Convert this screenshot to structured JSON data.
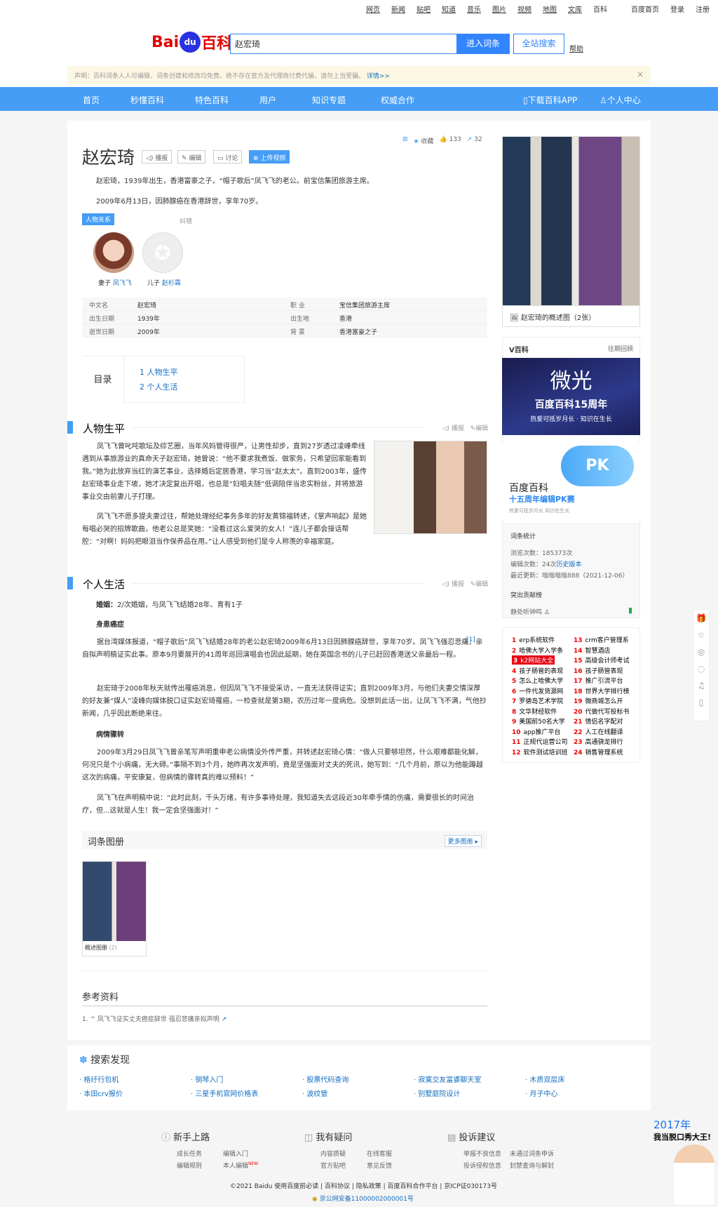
{
  "topnav": {
    "links": [
      "网页",
      "新闻",
      "贴吧",
      "知道",
      "音乐",
      "图片",
      "视频",
      "地图",
      "文库",
      "百科"
    ],
    "right": [
      "百度首页",
      "登录",
      "注册"
    ]
  },
  "header": {
    "logo_bai": "Bai",
    "logo_du": "du",
    "logo_baike": "百科",
    "search_value": "赵宏琦",
    "enter_label": "进入词条",
    "all_search_label": "全站搜索",
    "help_label": "帮助"
  },
  "notice": {
    "text": "声明：百科词条人人可编辑，词条创建和修改均免费，绝不存在官方及代理商付费代编，请勿上当受骗。",
    "link": "详情>>",
    "close": "×"
  },
  "nav": {
    "items": [
      "首页",
      "秒懂百科",
      "特色百科",
      "用户",
      "知识专题",
      "权威合作"
    ],
    "download": "下载百科APP",
    "user_center": "个人中心"
  },
  "entry": {
    "title": "赵宏琦",
    "buttons": [
      "播报",
      "编辑",
      "讨论",
      "上传视频"
    ],
    "collect": "收藏",
    "likes": "133",
    "shares": "32",
    "summary1": "赵宏琦，1939年出生，香港富豪之子，“帽子歌后”凤飞飞的老公。前宝信集团旅游主席。",
    "summary2": "2009年6月13日，因肺腺癌在香港辞世，享年70岁。",
    "relation_tag": "人物关系",
    "relation_error": "纠错",
    "relatives": [
      {
        "role": "妻子",
        "name": "凤飞飞"
      },
      {
        "role": "儿子",
        "name": "赵杉霖"
      }
    ],
    "info": [
      {
        "k1": "中文名",
        "v1": "赵宏琦",
        "k2": "职    业",
        "v2": "宝信集团旅游主席"
      },
      {
        "k1": "出生日期",
        "v1": "1939年",
        "k2": "出生地",
        "v2": "香港"
      },
      {
        "k1": "逝世日期",
        "v1": "2009年",
        "k2": "背    景",
        "v2": "香港富豪之子"
      }
    ],
    "toc_label": "目录",
    "toc": [
      "1   人物生平",
      "2   个人生活"
    ]
  },
  "section1": {
    "title": "人物生平",
    "read": "播报",
    "edit": "编辑",
    "p1": "凤飞飞曾叱咤歌坛及综艺圈，当年风妈管得很严，让男性却步，直到27岁透过凌峰牵线遇到从事旅游业的真命天子赵宏琦，她曾说：“他不要求我煮饭、做家务，只希望回家能看到我。”她为此放弃当红的演艺事业，选择婚后定居香港，学习当“赵太太”。直到2003年，盛传赵宏琦事业走下坡，她才决定复出开唱，也总是“妇唱夫随”低调陪伴当忠实粉丝，并将旅游事业交由前妻儿子打理。",
    "p2": "凤飞飞不愿多提夫妻过往，帮她处理经纪事务多年的好友黄锦福转述，《掌声响起》是她每唱必哭的招牌歌曲，他老公总是笑她：“没看过这么爱哭的女人！”连儿子都会接话帮腔：“对啊！妈妈把眼泪当作保养品在用。”让人感受到他们是令人称羡的幸福家庭。"
  },
  "section2": {
    "title": "个人生活",
    "read": "播报",
    "edit": "编辑",
    "marriage_label": "婚姻：",
    "marriage": "2/次婚姻，与凤飞飞结婚28年、育有1子",
    "sub1": "身患癌症",
    "p1": "据台湾媒体报道，“帽子歌后”凤飞飞结婚28年的老公赵宏琦2009年6月13日因肺腺癌辞世，享年70岁。凤飞飞强忍悲痛，亲自拟声明稿证实此事。原本9月要展开的41周年巡回演唱会也因此延期，她在英国念书的儿子已赶回香港送父亲最后一程。",
    "ref_mark": "[1]",
    "p2": "赵宏琦于2008年秋天就传出罹癌消息，但因凤飞飞不接受采访，一直无法获得证实；直到2009年3月，与他们夫妻交情深厚的好友兼“媒人”凌峰向媒体脱口证实赵宏琦罹癌，一检查就是第3期，农历过年一度病危。没想到此话一出，让凤飞飞不满，气他抄新闻，几乎因此断绝来往。",
    "sub2": "病情骤转",
    "p3": "2009年3月29日凤飞飞曾亲笔写声明重申老公病情没外传严重，并转述赵宏琦心情：“做人只要够坦然，什么艰难都能化解，何况只是个小病痛，无大碍。”事隔不到3个月，她昨再次发声明，竟是坚强面对丈夫的死讯，她写到：“几个月前，原以为他能蹲越这次的病痛，平安康复，但病情的骤转真的难以预料！”",
    "p4": "凤飞飞在声明稿中说：“此时此刻，千头万绪，有许多事待处理，我知道失去这段近30年牵手情的伤痛，需要很长的时间治疗，但...这就是人生！我一定会坚强面对！”"
  },
  "gallery": {
    "title": "词条图册",
    "more": "更多图册",
    "caption": "概述图册",
    "count": "(2)"
  },
  "references": {
    "title": "参考资料",
    "items": [
      "1.  ^  凤飞飞证实丈夫癌症辞世 强忍悲痛亲拟声明"
    ]
  },
  "sidebar": {
    "album_caption": "赵宏琦的概述图（2张）",
    "v_title": "V百科",
    "v_more": "往期回顾",
    "banner1_big": "微光",
    "banner1_title": "百度百科15周年",
    "banner1_sub": "热爱可抵岁月长 · 知识在生长",
    "banner2_title": "百度百科",
    "banner2_sub": "十五周年编辑PK赛",
    "banner2_pk": "PK",
    "banner2_tiny": "热爱可抵岁月长  知识在生长",
    "stats_title": "词条统计",
    "views_label": "浏览次数：",
    "views": "185373次",
    "edits_label": "编辑次数：",
    "edits": "24次",
    "history": "历史版本",
    "updated_label": "最近更新：",
    "updated": "嗡嗡嗡嗡888（2021-12-06）",
    "contrib_title": "突出贡献榜",
    "contrib_user": "静处听钟鸣",
    "hot": [
      "erp系统软件",
      "crm客户管理系",
      "哈佛大学入学条",
      "智慧酒店",
      "k2网站大全",
      "高级会计师考试",
      "孩子肠管的表现",
      "孩子肠管表现",
      "怎么上哈佛大学",
      "推广引流平台",
      "一件代发货源网",
      "世界大学排行榜",
      "罗德岛艺术学院",
      "微商城怎么开",
      "文华财经软件",
      "代做代写投标书",
      "美国前50名大学",
      "情侣名字配对",
      "app推广平台",
      "人工在线翻译",
      "正规代运营公司",
      "高通骁龙排行",
      "软件测试培训班",
      "销售管理系统"
    ]
  },
  "discover": {
    "title": "搜索发现",
    "links": [
      "格纡行包机",
      "钢琴入门",
      "股票代码查询",
      "寂寞交友富婆聊天室",
      "木质双层床",
      "本田crv报价",
      "三星手机官网价格表",
      "波纹管",
      "别墅庭院设计",
      "月子中心"
    ]
  },
  "footer": {
    "col1_title": "新手上路",
    "col1": [
      "成长任务",
      "编辑入门",
      "编辑规则",
      "本人编辑"
    ],
    "new_badge": "NEW",
    "col2_title": "我有疑问",
    "col2": [
      "内容质疑",
      "在线客服",
      "官方贴吧",
      "意见反馈"
    ],
    "col3_title": "投诉建议",
    "col3": [
      "举报不良信息",
      "未通过词条申诉",
      "投诉侵权信息",
      "封禁查询与解封"
    ],
    "copyright": "©2021 Baidu 使用百度前必读 | 百科协议 | 隐私政策 | 百度百科合作平台 | 京ICP证030173号",
    "police": "京公网安备11000002000001号"
  },
  "promo": {
    "year": "2017年",
    "text": "我当脱口秀大王!"
  },
  "colors": {
    "accent": "#459df5",
    "link": "#136ec2",
    "brand_red": "#e10601"
  }
}
